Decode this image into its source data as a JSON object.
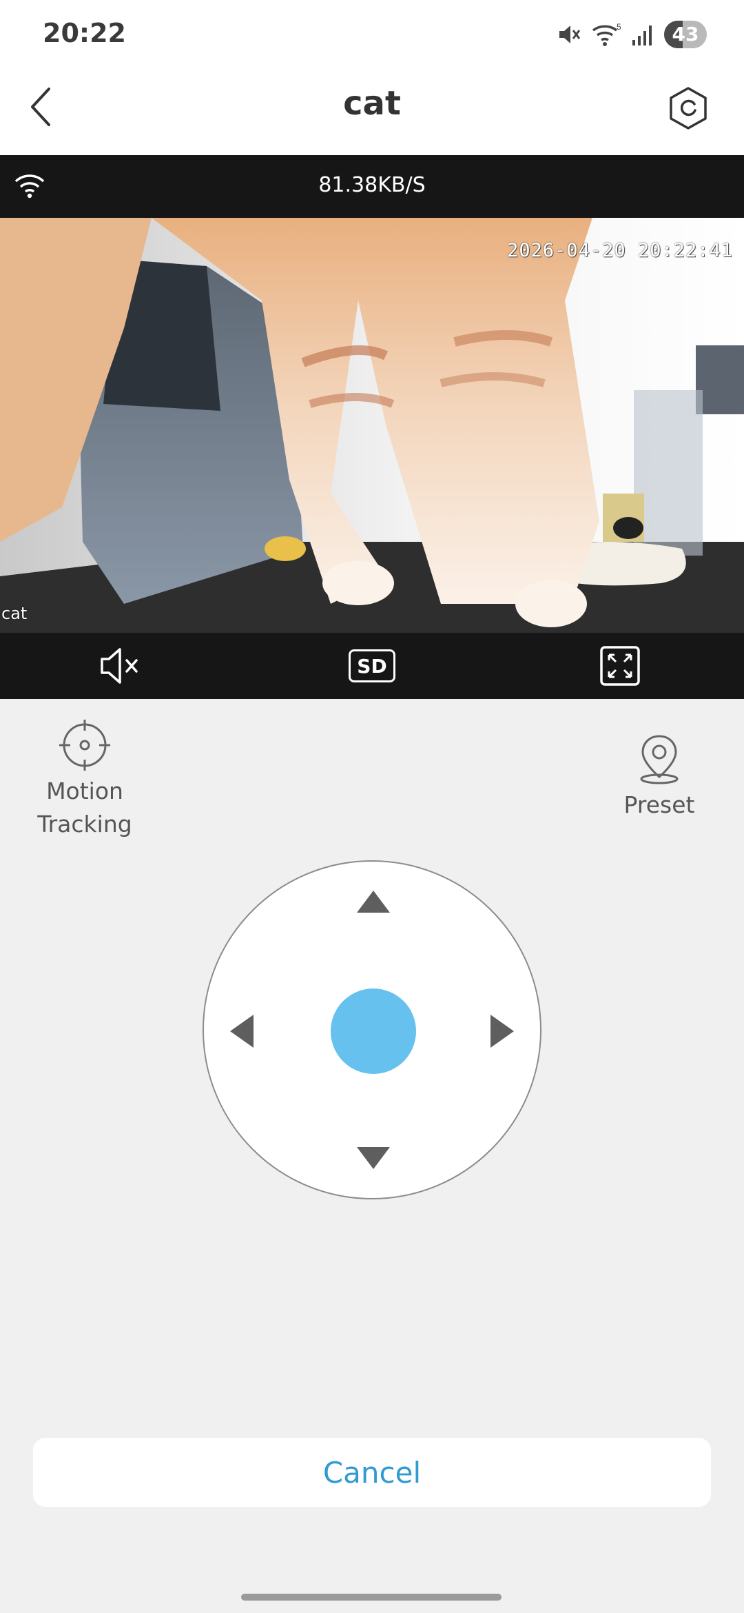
{
  "status_bar": {
    "time": "20:22",
    "battery": "43",
    "battery_fraction": 0.43,
    "signal_label": "5",
    "icons": [
      "mute-icon",
      "wifi-icon",
      "cell-signal-icon",
      "battery-icon"
    ]
  },
  "header": {
    "title": "cat",
    "back_icon": "chevron-left-icon",
    "settings_icon": "gear-icon"
  },
  "video": {
    "speed": "81.38KB/S",
    "timestamp": "2026-04-20 20:22:41",
    "camera_label": "cat",
    "controls": [
      "mute-icon",
      "SD",
      "fullscreen-icon"
    ]
  },
  "video_controls": {
    "quality_label": "SD"
  },
  "features": {
    "motion_tracking": "Motion\nTracking",
    "preset": "Preset"
  },
  "ptz": {
    "center_color": "#66c1ee"
  },
  "footer": {
    "cancel": "Cancel"
  },
  "colors": {
    "accent": "#2f9bd0",
    "video_bar": "#161616",
    "background": "#f0f0f0"
  }
}
